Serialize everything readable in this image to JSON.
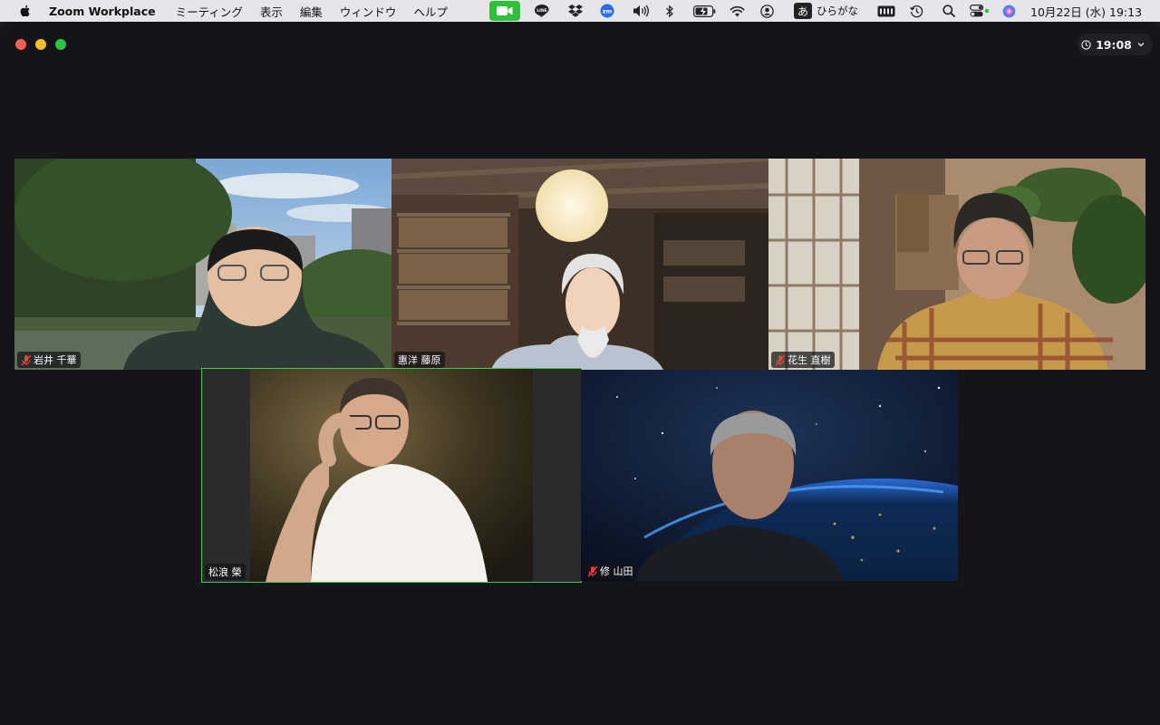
{
  "menubar": {
    "app_name": "Zoom Workplace",
    "menus": [
      "ミーティング",
      "表示",
      "編集",
      "ウィンドウ",
      "ヘルプ"
    ],
    "tray_icons": [
      "zoom-video-icon",
      "line-icon",
      "dropbox-icon",
      "zoom-app-icon",
      "volume-icon",
      "bluetooth-icon",
      "battery-icon",
      "wifi-icon",
      "user-icon",
      "input-method-icon",
      "keyboard-icon",
      "time-machine-icon",
      "search-icon",
      "control-center-icon",
      "siri-icon"
    ],
    "line_label": "LINE",
    "zoom_label": "zm",
    "input_method_glyph": "あ",
    "input_method_label": "ひらがな",
    "datetime": "10月22日 (水)  19:13"
  },
  "window": {
    "timer": "19:08"
  },
  "participants": [
    {
      "name": "岩井 千華",
      "muted": true,
      "speaking": false
    },
    {
      "name": "惠洋 藤原",
      "muted": false,
      "speaking": false
    },
    {
      "name": "花生 直樹",
      "muted": true,
      "speaking": false
    },
    {
      "name": "松浪 榮",
      "muted": false,
      "speaking": true
    },
    {
      "name": "修 山田",
      "muted": true,
      "speaking": false
    }
  ],
  "colors": {
    "active_speaker": "#3fcf4a",
    "mute_icon": "#e8423b",
    "window_bg": "#141519"
  }
}
